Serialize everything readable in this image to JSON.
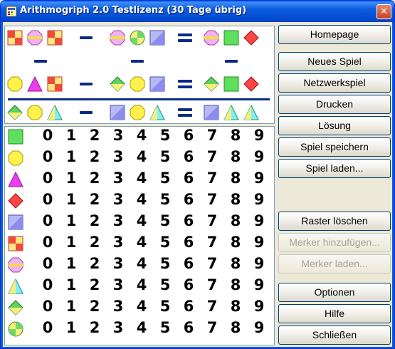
{
  "window": {
    "title": "Arithmogriph 2.0 Testlizenz (30 Tage übrig)",
    "close_glyph": "✕"
  },
  "icons": {
    "app": "calculator-icon",
    "close": "close-icon"
  },
  "colors": {
    "titlebar": "#0b5ddb",
    "frame": "#ece9d8",
    "operator": "#0a2a8a"
  },
  "buttons": {
    "homepage": "Homepage",
    "new_game": "Neues Spiel",
    "network_game": "Netzwerkspiel",
    "print": "Drucken",
    "solution": "Lösung",
    "save_game": "Spiel speichern",
    "load_game": "Spiel laden...",
    "clear_grid": "Raster löschen",
    "add_marker": "Merker hinzufügen...",
    "load_marker": "Merker laden...",
    "options": "Optionen",
    "help": "Hilfe",
    "close": "Schließen"
  },
  "puzzle": {
    "operators": {
      "minus": "-",
      "equals": "="
    },
    "rows": [
      {
        "a": [
          "checker",
          "pink-octagon",
          "checker"
        ],
        "op": "-",
        "b": [
          "pink-octagon",
          "green-yellow-circle",
          "blue-square"
        ],
        "res": [
          "pink-octagon",
          "green-square",
          "red-diamond"
        ]
      },
      {
        "a": [
          "yellow-octagon",
          "magenta-triangle",
          "checker"
        ],
        "op": "-",
        "b": [
          "green-diamond",
          "yellow-octagon",
          "blue-square"
        ],
        "res": [
          "green-diamond",
          "green-square",
          "red-diamond"
        ]
      },
      {
        "a": [
          "green-diamond",
          "yellow-octagon",
          "cyan-triangle"
        ],
        "op": "-",
        "b": [
          "blue-square",
          "yellow-octagon",
          "cyan-triangle"
        ],
        "res": [
          "blue-square",
          "cyan-triangle",
          "cyan-triangle"
        ]
      }
    ]
  },
  "digits": [
    "0",
    "1",
    "2",
    "3",
    "4",
    "5",
    "6",
    "7",
    "8",
    "9"
  ],
  "grid_rows": [
    "green-square",
    "yellow-octagon",
    "magenta-triangle",
    "red-diamond",
    "blue-square",
    "checker",
    "pink-octagon",
    "cyan-triangle",
    "green-diamond",
    "green-yellow-circle"
  ]
}
